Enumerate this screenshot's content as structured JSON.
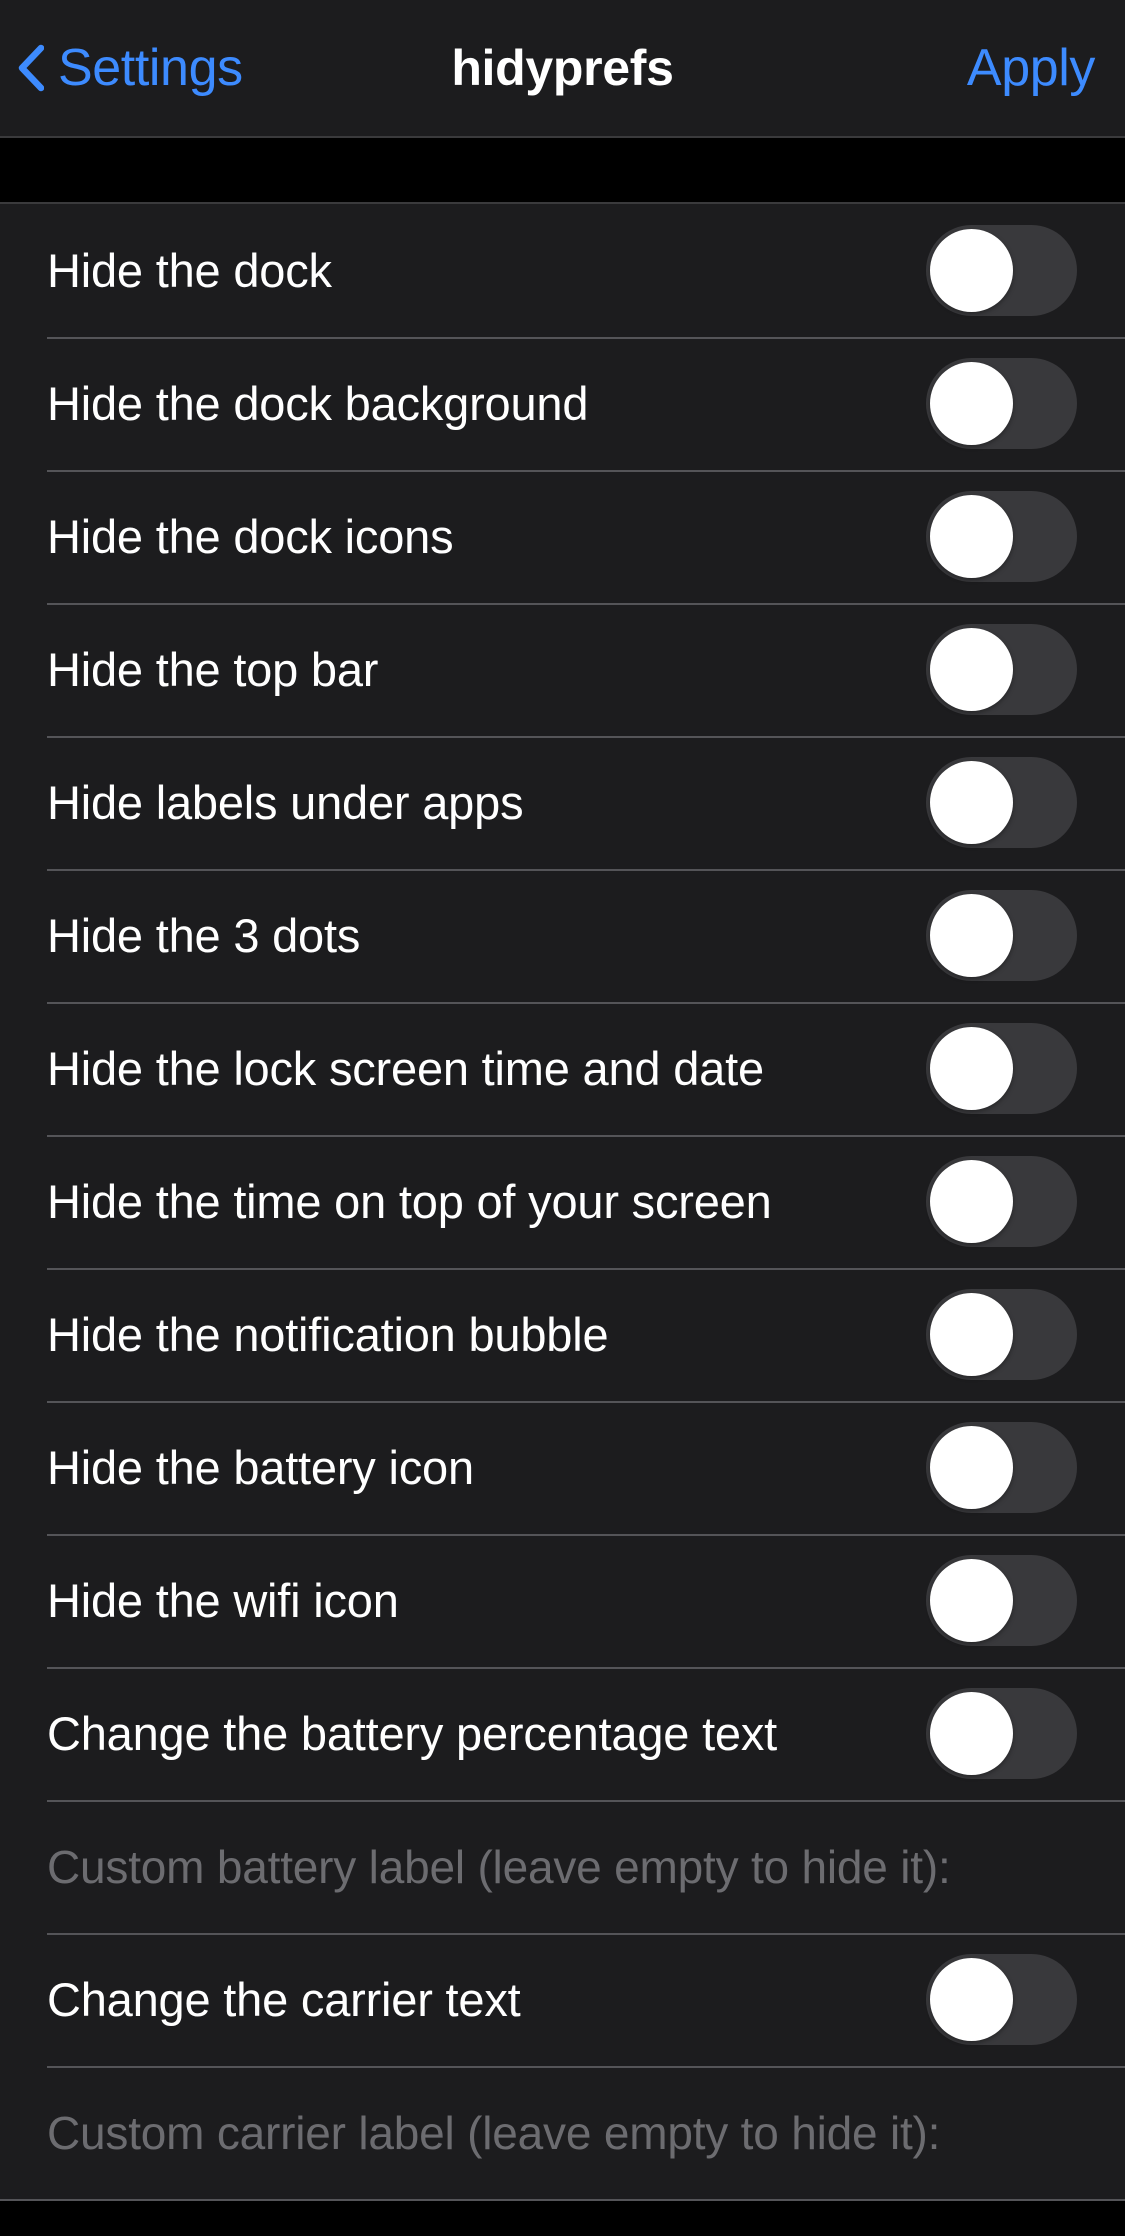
{
  "navbar": {
    "back_label": "Settings",
    "back_icon": "chevron-left-icon",
    "title": "hidyprefs",
    "action_label": "Apply"
  },
  "colors": {
    "accent_blue": "#3d8bff",
    "cell_background": "#1c1c1e",
    "page_background": "#000000",
    "separator": "#545458",
    "switch_track_off": "#39393c",
    "switch_knob": "#ffffff",
    "label_primary": "#ffffff",
    "label_dim": "#6c6c70"
  },
  "rows": [
    {
      "label": "Hide the dock",
      "type": "switch",
      "value": "off"
    },
    {
      "label": "Hide the dock background",
      "type": "switch",
      "value": "off"
    },
    {
      "label": "Hide the dock icons",
      "type": "switch",
      "value": "off"
    },
    {
      "label": "Hide the top bar",
      "type": "switch",
      "value": "off"
    },
    {
      "label": "Hide labels under apps",
      "type": "switch",
      "value": "off"
    },
    {
      "label": "Hide the 3 dots",
      "type": "switch",
      "value": "off"
    },
    {
      "label": "Hide the lock screen time and date",
      "type": "switch",
      "value": "off"
    },
    {
      "label": "Hide the time on top of your screen",
      "type": "switch",
      "value": "off"
    },
    {
      "label": "Hide the notification bubble",
      "type": "switch",
      "value": "off"
    },
    {
      "label": "Hide the battery icon",
      "type": "switch",
      "value": "off"
    },
    {
      "label": "Hide the wifi icon",
      "type": "switch",
      "value": "off"
    },
    {
      "label": "Change the battery percentage text",
      "type": "switch",
      "value": "off"
    },
    {
      "label": "Custom battery label  (leave empty to hide it):",
      "type": "textfield",
      "value": ""
    },
    {
      "label": "Change the carrier text",
      "type": "switch",
      "value": "off"
    },
    {
      "label": "Custom carrier label (leave empty to hide it):",
      "type": "textfield",
      "value": ""
    }
  ]
}
